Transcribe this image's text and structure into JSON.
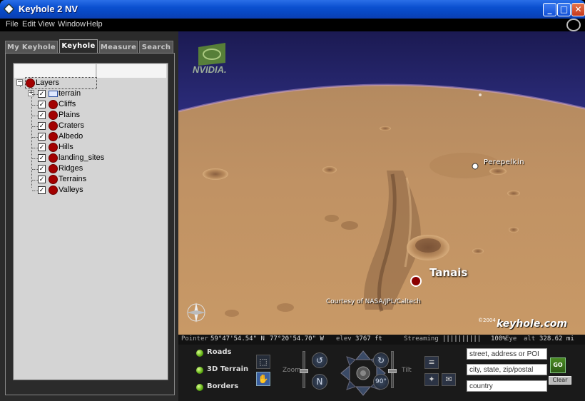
{
  "window": {
    "title": "Keyhole 2 NV",
    "min_glyph": "_",
    "max_glyph": "□",
    "close_glyph": "✕"
  },
  "menu": {
    "items": [
      "File",
      "Edit",
      "View",
      "Window",
      "Help"
    ]
  },
  "tabs": [
    "My Keyhole",
    "Keyhole",
    "Measure",
    "Search"
  ],
  "active_tab": "Keyhole",
  "layers": {
    "root": "Layers",
    "items": [
      {
        "label": "terrain",
        "type": "folder",
        "checked": true
      },
      {
        "label": "Cliffs",
        "checked": true
      },
      {
        "label": "Plains",
        "checked": true
      },
      {
        "label": "Craters",
        "checked": true
      },
      {
        "label": "Albedo",
        "checked": true
      },
      {
        "label": "Hills",
        "checked": true
      },
      {
        "label": "landing_sites",
        "checked": true
      },
      {
        "label": "Ridges",
        "checked": true
      },
      {
        "label": "Terrains",
        "checked": true
      },
      {
        "label": "Valleys",
        "checked": true
      }
    ]
  },
  "map": {
    "logo": "NVIDIA.",
    "places": {
      "primary": "Tanais",
      "secondary": "Perepelkin"
    },
    "credit": "Courtesy of NASA/JPL/Caltech",
    "copyright": "©2004",
    "brand": "keyhole.com"
  },
  "status": {
    "pointer_label": "Pointer",
    "lat": "59°47'54.54\" N",
    "lon": "77°20'54.70\"  W",
    "elev_label": "elev",
    "elev": "3767 ft",
    "streaming_label": "Streaming",
    "streaming_bar": "||||||||||",
    "streaming_pct": "100%",
    "eye_label": "Eye",
    "alt_label": "alt",
    "alt": "328.62 mi"
  },
  "controls": {
    "layer_toggles": [
      "Roads",
      "3D Terrain",
      "Borders"
    ],
    "zoom_label": "Zoom",
    "tilt_label": "Tilt",
    "tilt_value": "90°",
    "north": "N",
    "search": {
      "address_placeholder": "street, address or POI",
      "city_placeholder": "city, state, zip/postal",
      "country_placeholder": "country"
    },
    "go_label": "GO",
    "clear_label": "Clear"
  }
}
